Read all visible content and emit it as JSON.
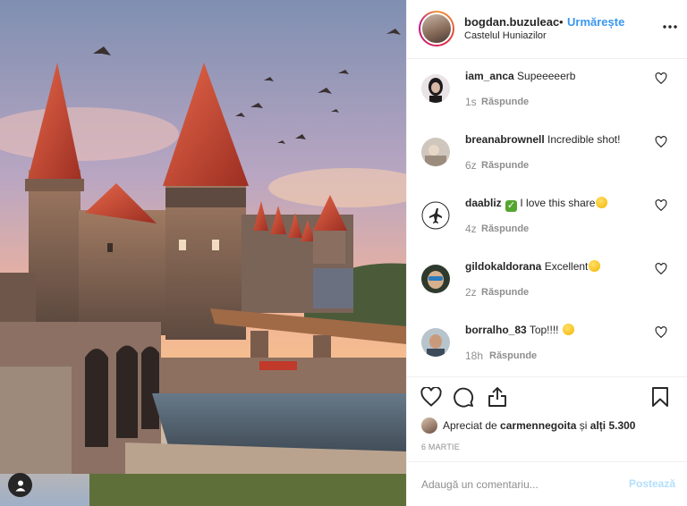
{
  "post": {
    "author": "bogdan.buzuleac",
    "separator": "•",
    "follow_label": "Urmărește",
    "location": "Castelul Huniazilor",
    "more_icon": "more-dots-icon"
  },
  "comments": [
    {
      "username": "iam_anca",
      "text": "Supeeeeerb",
      "time": "1s",
      "reply_label": "Răspunde",
      "emoji": ""
    },
    {
      "username": "breanabrownell",
      "text": "Incredible shot!",
      "time": "6z",
      "reply_label": "Răspunde",
      "emoji": ""
    },
    {
      "username": "daabliz",
      "text_before": "",
      "text": "I love this share",
      "time": "4z",
      "reply_label": "Răspunde",
      "emoji_before": "check-mark-emoji",
      "emoji": "hand-emoji"
    },
    {
      "username": "gildokaldorana",
      "text": "Excellent",
      "time": "2z",
      "reply_label": "Răspunde",
      "emoji": "grinning-face-emoji"
    },
    {
      "username": "borralho_83",
      "text": "Top!!!!",
      "time": "18h",
      "reply_label": "Răspunde",
      "emoji": "money-bag-emoji"
    }
  ],
  "actions": {
    "like_icon": "heart-icon",
    "comment_icon": "comment-icon",
    "share_icon": "share-icon",
    "save_icon": "bookmark-icon"
  },
  "likes": {
    "prefix": "Apreciat de",
    "user": "carmennegoita",
    "suffix_pre": "și",
    "others": "alți 5.300"
  },
  "date": "6 MARTIE",
  "add_comment": {
    "placeholder": "Adaugă un comentariu...",
    "post_label": "Postează"
  },
  "colors": {
    "accent": "#3897f0",
    "post_disabled": "#b2dffc",
    "muted": "#8e8e8e",
    "text": "#262626",
    "border": "#efefef"
  }
}
